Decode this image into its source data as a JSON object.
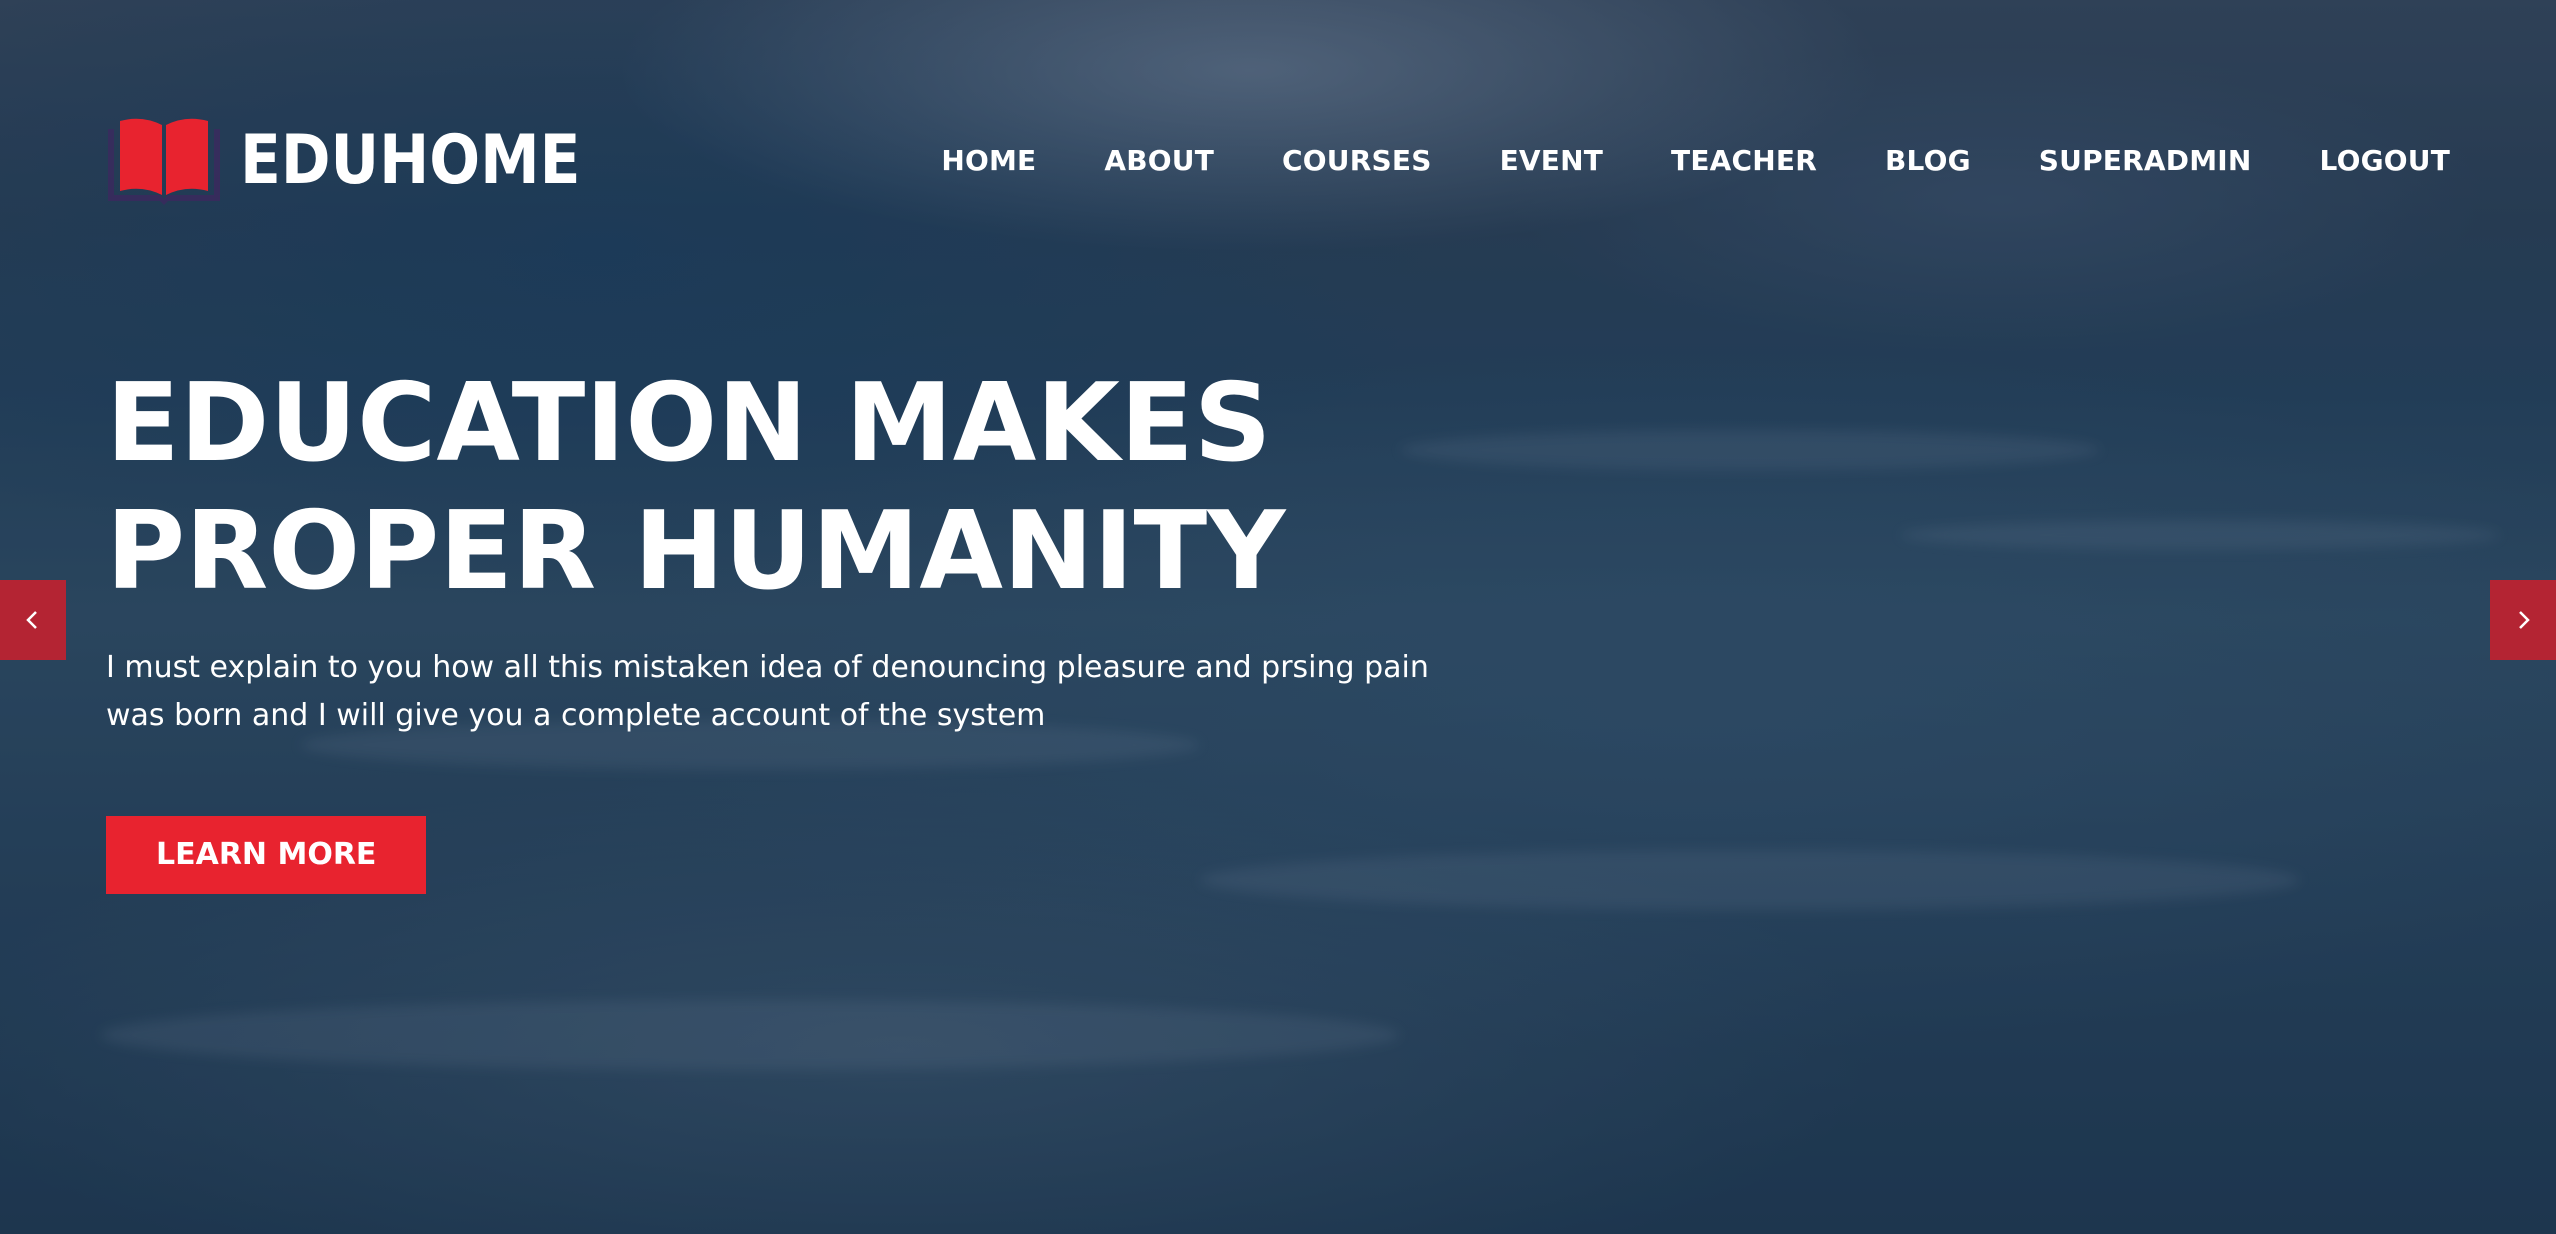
{
  "brand": {
    "name": "EDUHOME",
    "logo_icon": "book-icon",
    "logo_color": "#e8232f"
  },
  "nav": {
    "items": [
      {
        "label": "HOME"
      },
      {
        "label": "ABOUT"
      },
      {
        "label": "COURSES"
      },
      {
        "label": "EVENT"
      },
      {
        "label": "TEACHER"
      },
      {
        "label": "BLOG"
      },
      {
        "label": "SUPERADMIN"
      },
      {
        "label": "LOGOUT"
      }
    ]
  },
  "hero": {
    "headline_line1": "EDUCATION MAKES",
    "headline_line2": "PROPER HUMANITY",
    "subtitle_line1": "I must explain to you how all this mistaken idea of denouncing pleasure and prsing pain",
    "subtitle_line2": "was born and I will give you a complete account of the system",
    "cta_label": "LEARN MORE",
    "cta_color": "#e8232f"
  },
  "slider": {
    "prev_icon": "chevron-left-icon",
    "next_icon": "chevron-right-icon",
    "arrow_color": "#cc1e2c"
  }
}
